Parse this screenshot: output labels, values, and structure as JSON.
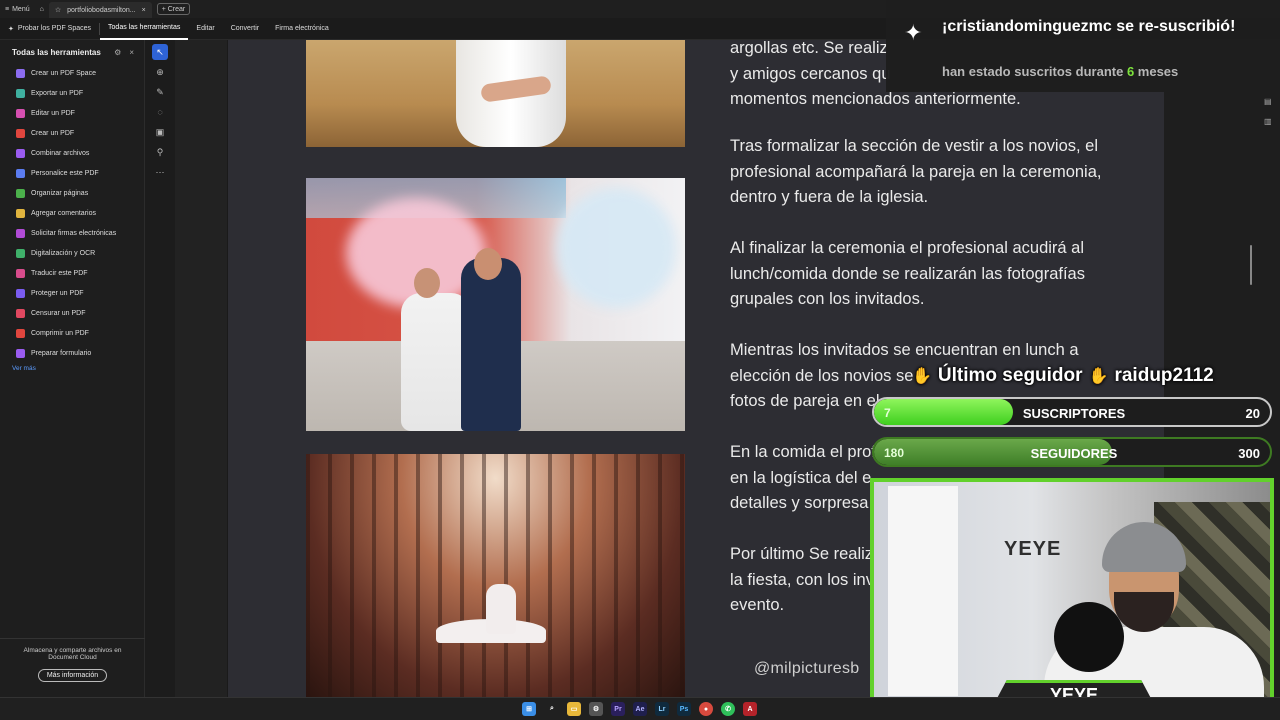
{
  "browser": {
    "menu": "Menú",
    "tab_title": "portfoliobodasmilton...",
    "new_button": "+ Crear"
  },
  "menubar": {
    "spaces": "Probar los PDF Spaces",
    "items": [
      "Todas las herramientas",
      "Editar",
      "Convertir",
      "Firma electrónica"
    ]
  },
  "tools_panel": {
    "title": "Todas las herramientas",
    "items": [
      {
        "label": "Crear un PDF Space",
        "color": "#8b6cf0"
      },
      {
        "label": "Exportar un PDF",
        "color": "#3fb0a0"
      },
      {
        "label": "Editar un PDF",
        "color": "#d64fb0"
      },
      {
        "label": "Crear un PDF",
        "color": "#e0463e"
      },
      {
        "label": "Combinar archivos",
        "color": "#9a5cf0"
      },
      {
        "label": "Personalice este PDF",
        "color": "#5b7cf0"
      },
      {
        "label": "Organizar páginas",
        "color": "#4bb04b"
      },
      {
        "label": "Agregar comentarios",
        "color": "#e0b43e"
      },
      {
        "label": "Solicitar firmas electrónicas",
        "color": "#b04bd6"
      },
      {
        "label": "Digitalización y OCR",
        "color": "#3fb06a"
      },
      {
        "label": "Traducir este PDF",
        "color": "#d84c8c"
      },
      {
        "label": "Proteger un PDF",
        "color": "#7a5cf0"
      },
      {
        "label": "Censurar un PDF",
        "color": "#e04860"
      },
      {
        "label": "Comprimir un PDF",
        "color": "#e0463e"
      },
      {
        "label": "Preparar formulario",
        "color": "#9a5cf0"
      }
    ],
    "see_more": "Ver más",
    "footer_text": "Almacena y comparte archivos en Document Cloud",
    "footer_button": "Más información"
  },
  "document": {
    "paragraphs": [
      {
        "lines": [
          "argollas etc. Se realiz",
          "y amigos cercanos qu",
          "momentos mencionados anteriormente."
        ]
      },
      {
        "lines": [
          "Tras formalizar la sección de vestir a los novios, el",
          "profesional acompañará la pareja en la ceremonia,",
          "dentro y fuera de la iglesia."
        ]
      },
      {
        "lines": [
          "Al finalizar la ceremonia el profesional acudirá al",
          "lunch/comida donde se realizarán las fotografías",
          "grupales con los invitados."
        ]
      },
      {
        "lines": [
          "Mientras los invitados se encuentran en lunch a",
          "elección de los novios se",
          "fotos de pareja en el"
        ]
      },
      {
        "lines": [
          "En la comida el prof",
          "en la logística del e",
          "detalles y sorpresa"
        ]
      },
      {
        "lines": [
          "Por último Se realiz",
          "la fiesta, con los inv",
          "evento."
        ]
      }
    ],
    "credit": "@milpicturesb"
  },
  "overlay": {
    "notification_title": "¡cristiandominguezmc se re-suscribió!",
    "notification_sub_prefix": "han estado suscritos durante ",
    "notification_sub_num": "6",
    "notification_sub_suffix": " meses",
    "follower_label": "Último seguidor",
    "follower_name": "raidup2112",
    "subs": {
      "current": "7",
      "label": "SUSCRIPTORES",
      "goal": "20",
      "progress": 0.35
    },
    "followers": {
      "current": "180",
      "label": "SEGUIDORES",
      "goal": "300",
      "progress": 0.6
    },
    "webcam_brand": "YEYE",
    "nameplate": "YEYE"
  }
}
